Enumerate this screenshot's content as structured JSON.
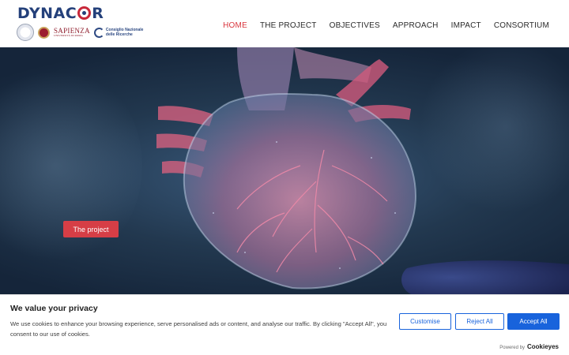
{
  "header": {
    "logo": "DYNACOR",
    "partners": {
      "sapienza_name": "SAPIENZA",
      "sapienza_sub": "UNIVERSITÀ DI ROMA",
      "cnr_line1": "Consiglio Nazionale",
      "cnr_line2": "delle Ricerche"
    },
    "nav": [
      {
        "label": "HOME",
        "active": true
      },
      {
        "label": "THE PROJECT",
        "active": false
      },
      {
        "label": "OBJECTIVES",
        "active": false
      },
      {
        "label": "APPROACH",
        "active": false
      },
      {
        "label": "IMPACT",
        "active": false
      },
      {
        "label": "CONSORTIUM",
        "active": false
      }
    ]
  },
  "hero": {
    "button_label": "The project"
  },
  "cookie_banner": {
    "title": "We value your privacy",
    "text": "We use cookies to enhance your browsing experience, serve personalised ads or content, and analyse our traffic. By clicking \"Accept All\", you consent to our use of cookies.",
    "customise_label": "Customise",
    "reject_label": "Reject All",
    "accept_label": "Accept All",
    "powered_by": "Powered by",
    "powered_brand": "Cookieyes"
  },
  "colors": {
    "brand_blue": "#24407a",
    "brand_red": "#c8283a",
    "nav_active": "#d9363e",
    "cookie_blue": "#1863dc"
  }
}
